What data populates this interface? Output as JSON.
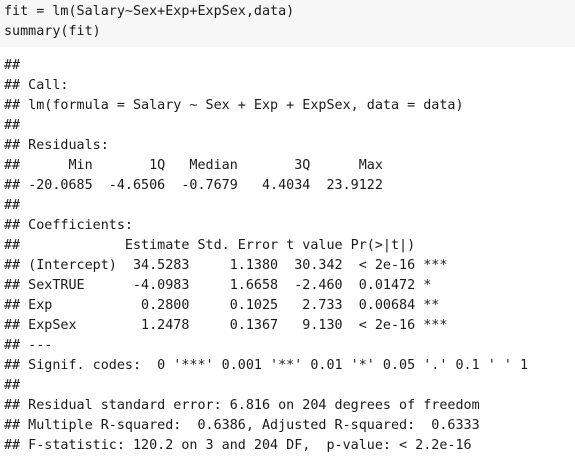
{
  "code": {
    "lines": [
      "fit = lm(Salary~Sex+Exp+ExpSex,data)",
      "summary(fit)"
    ]
  },
  "output": {
    "lines": [
      "##",
      "## Call:",
      "## lm(formula = Salary ~ Sex + Exp + ExpSex, data = data)",
      "##",
      "## Residuals:",
      "##      Min       1Q   Median       3Q      Max",
      "## -20.0685  -4.6506  -0.7679   4.4034  23.9122",
      "##",
      "## Coefficients:",
      "##             Estimate Std. Error t value Pr(>|t|)",
      "## (Intercept)  34.5283     1.1380  30.342  < 2e-16 ***",
      "## SexTRUE      -4.0983     1.6658  -2.460  0.01472 *",
      "## Exp           0.2800     0.1025   2.733  0.00684 **",
      "## ExpSex        1.2478     0.1367   9.130  < 2e-16 ***",
      "## ---",
      "## Signif. codes:  0 '***' 0.001 '**' 0.01 '*' 0.05 '.' 0.1 ' ' 1",
      "##",
      "## Residual standard error: 6.816 on 204 degrees of freedom",
      "## Multiple R-squared:  0.6386, Adjusted R-squared:  0.6333",
      "## F-statistic: 120.2 on 3 and 204 DF,  p-value: < 2.2e-16"
    ]
  }
}
